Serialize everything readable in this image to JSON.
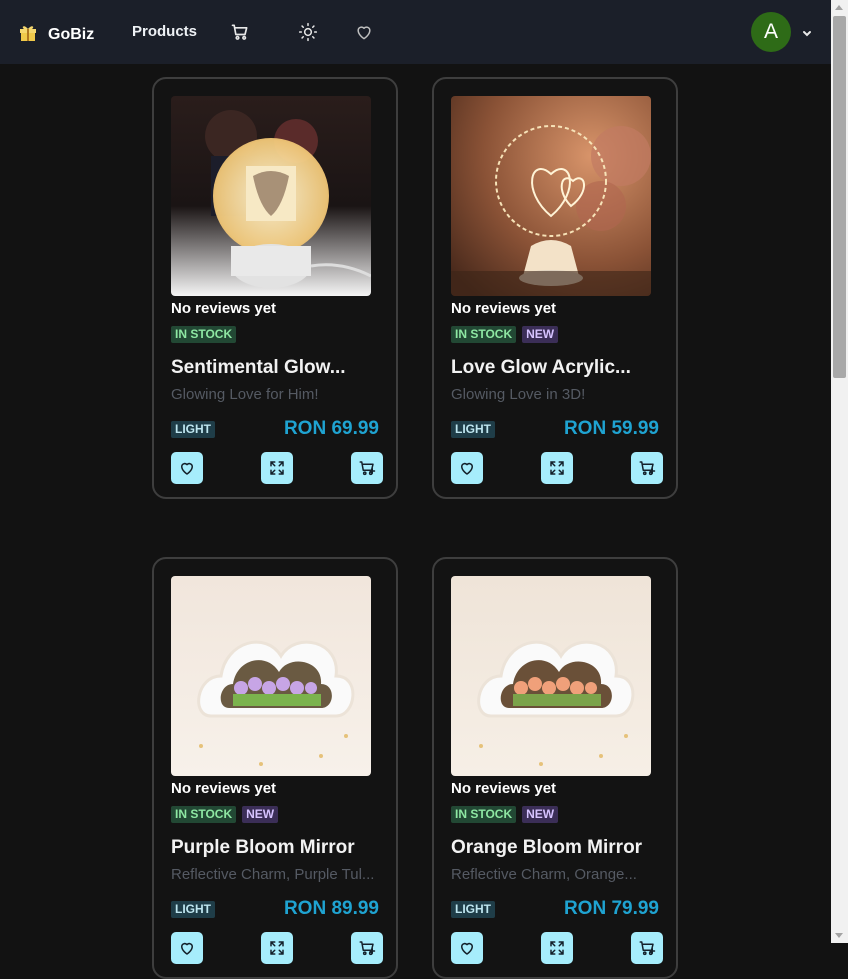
{
  "navbar": {
    "brand_name": "GoBiz",
    "brand_icon": "gift-icon",
    "products_label": "Products",
    "icons": [
      "cart-icon",
      "sun-icon",
      "heart-icon"
    ],
    "avatar_initial": "A",
    "accent_color": "#2e6b17"
  },
  "products": [
    {
      "reviews": "No reviews yet",
      "in_stock_label": "IN STOCK",
      "is_new": false,
      "title": "Sentimental Glow...",
      "subtitle": "Glowing Love for Him!",
      "category": "LIGHT",
      "price": "RON 69.99",
      "image": "husband-night-lamp"
    },
    {
      "reviews": "No reviews yet",
      "in_stock_label": "IN STOCK",
      "new_label": "NEW",
      "is_new": true,
      "title": "Love Glow Acrylic...",
      "subtitle": "Glowing Love in 3D!",
      "category": "LIGHT",
      "price": "RON 59.99",
      "image": "heart-acrylic-lamp"
    },
    {
      "reviews": "No reviews yet",
      "in_stock_label": "IN STOCK",
      "new_label": "NEW",
      "is_new": true,
      "title": "Purple Bloom Mirror",
      "subtitle": "Reflective Charm, Purple Tul...",
      "category": "LIGHT",
      "price": "RON 89.99",
      "image": "purple-tulip-cloud-mirror"
    },
    {
      "reviews": "No reviews yet",
      "in_stock_label": "IN STOCK",
      "new_label": "NEW",
      "is_new": true,
      "title": "Orange Bloom Mirror",
      "subtitle": "Reflective Charm, Orange...",
      "category": "LIGHT",
      "price": "RON 79.99",
      "image": "orange-tulip-cloud-mirror"
    }
  ],
  "colors": {
    "price": "#1fa3d1",
    "action_button": "#a6edfc",
    "background": "#121212"
  }
}
